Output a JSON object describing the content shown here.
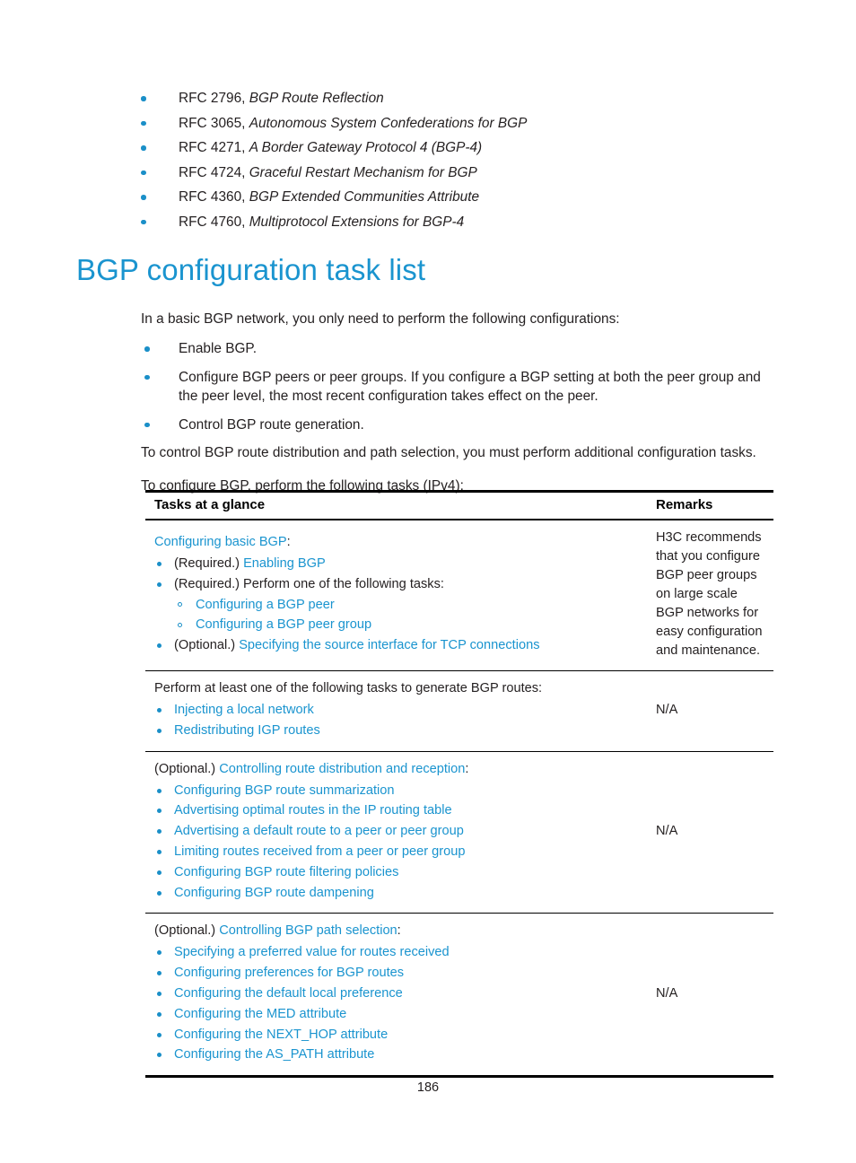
{
  "rfc_list": [
    {
      "prefix": "RFC 2796, ",
      "title": "BGP Route Reflection"
    },
    {
      "prefix": "RFC 3065, ",
      "title": "Autonomous System Confederations for BGP"
    },
    {
      "prefix": "RFC 4271, ",
      "title": "A Border Gateway Protocol 4 (BGP-4)"
    },
    {
      "prefix": "RFC 4724, ",
      "title": "Graceful Restart Mechanism for BGP"
    },
    {
      "prefix": "RFC 4360, ",
      "title": "BGP Extended Communities Attribute"
    },
    {
      "prefix": "RFC 4760, ",
      "title": "Multiprotocol Extensions for BGP-4"
    }
  ],
  "heading": "BGP configuration task list",
  "intro": {
    "lead": "In a basic BGP network, you only need to perform the following configurations:",
    "bullets": [
      "Enable BGP.",
      "Configure BGP peers or peer groups. If you configure a BGP setting at both the peer group and the peer level, the most recent configuration takes effect on the peer.",
      "Control BGP route generation."
    ],
    "tail1": "To control BGP route distribution and path selection, you must perform additional configuration tasks.",
    "tail2": "To configure BGP, perform the following tasks (IPv4):"
  },
  "table": {
    "headers": {
      "tasks": "Tasks at a glance",
      "remarks": "Remarks"
    },
    "rows": [
      {
        "lead_black": "",
        "lead_link": "Configuring basic BGP",
        "lead_suffix": ":",
        "items": [
          {
            "black": "(Required.) ",
            "link": "Enabling BGP"
          },
          {
            "black": "(Required.) Perform one of the following tasks:",
            "link": "",
            "sub": [
              "Configuring a BGP peer",
              "Configuring a BGP peer group"
            ]
          },
          {
            "black": "(Optional.) ",
            "link": "Specifying the source interface for TCP connections"
          }
        ],
        "remarks": "H3C recommends that you configure BGP peer groups on large scale BGP networks for easy configuration and maintenance."
      },
      {
        "lead_black": "Perform at least one of the following tasks to generate BGP routes:",
        "lead_link": "",
        "lead_suffix": "",
        "items": [
          {
            "black": "",
            "link": "Injecting a local network"
          },
          {
            "black": "",
            "link": "Redistributing IGP routes"
          }
        ],
        "remarks": "N/A"
      },
      {
        "lead_black": "(Optional.) ",
        "lead_link": "Controlling route distribution and reception",
        "lead_suffix": ":",
        "items": [
          {
            "black": "",
            "link": "Configuring BGP route summarization"
          },
          {
            "black": "",
            "link": "Advertising optimal routes in the IP routing table"
          },
          {
            "black": "",
            "link": "Advertising a default route to a peer or peer group"
          },
          {
            "black": "",
            "link": "Limiting routes received from a peer or peer group"
          },
          {
            "black": "",
            "link": "Configuring BGP route filtering policies"
          },
          {
            "black": "",
            "link": "Configuring BGP route dampening"
          }
        ],
        "remarks": "N/A"
      },
      {
        "lead_black": "(Optional.) ",
        "lead_link": "Controlling BGP path selection",
        "lead_suffix": ":",
        "items": [
          {
            "black": "",
            "link": "Specifying a preferred value for routes received"
          },
          {
            "black": "",
            "link": "Configuring preferences for BGP routes"
          },
          {
            "black": "",
            "link": "Configuring the default local preference"
          },
          {
            "black": "",
            "link": "Configuring the MED attribute"
          },
          {
            "black": "",
            "link": "Configuring the NEXT_HOP attribute"
          },
          {
            "black": "",
            "link": "Configuring the AS_PATH attribute"
          }
        ],
        "remarks": "N/A"
      }
    ]
  },
  "footer": {
    "page_number": "186"
  },
  "colors": {
    "link": "#1a94cf",
    "heading": "#1a94cf",
    "bullet": "#1a8fc8",
    "text": "#231f20"
  }
}
